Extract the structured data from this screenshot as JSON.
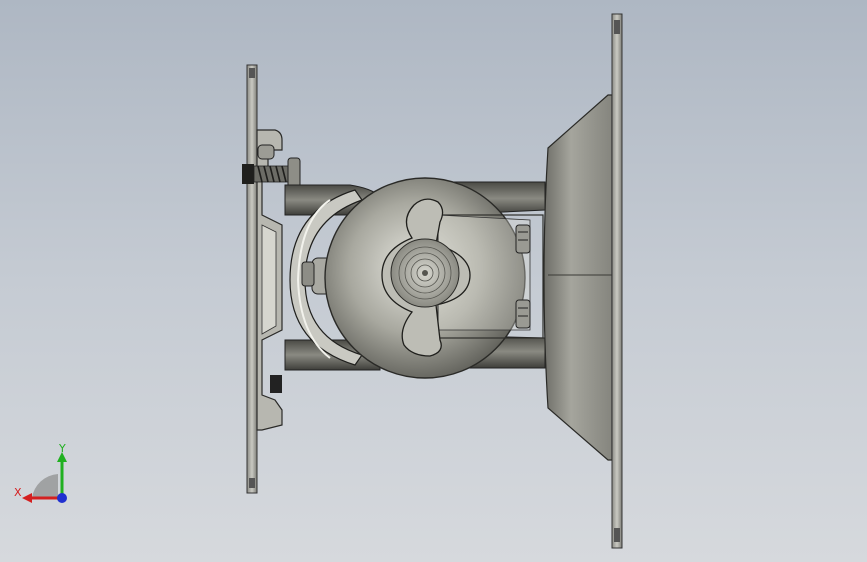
{
  "viewport": {
    "background_top": "#aeb7c3",
    "background_bottom": "#d6d9dd"
  },
  "model": {
    "description_icon": "wall-mount-bracket-model",
    "metal_color": "#9a9a92",
    "dark_color": "#3a3a36"
  },
  "triad": {
    "x_label": "X",
    "y_label": "Y",
    "x_color": "#d42020",
    "y_color": "#20b020",
    "z_color": "#2030d0"
  }
}
